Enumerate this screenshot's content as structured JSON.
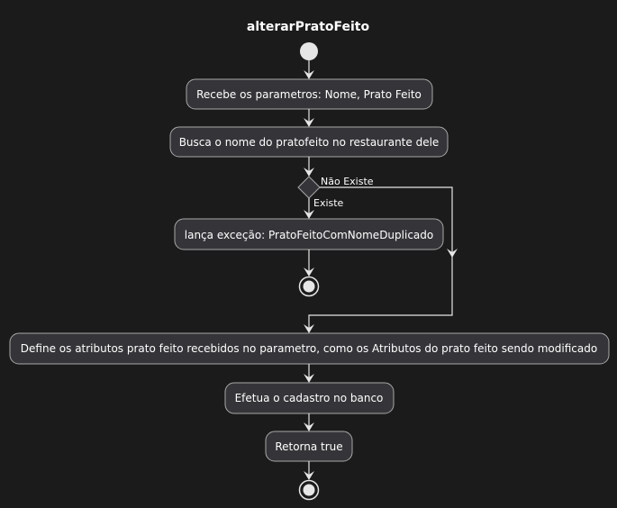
{
  "title": "alterarPratoFeito",
  "actions": {
    "receive_params": "Recebe os parametros: Nome, Prato Feito",
    "search_name": "Busca o nome do pratofeito no restaurante dele",
    "throw_exception": "lança exceção: PratoFeitoComNomeDuplicado",
    "define_attributes": "Define  os atributos prato feito recebidos no parametro, como os Atributos do prato feito sendo modificado",
    "register": "Efetua o cadastro no banco",
    "return_true": "Retorna true"
  },
  "decision": {
    "branch_false_label": "Não Existe",
    "branch_true_label": "Existe"
  },
  "colors": {
    "background": "#1b1b1c",
    "node_fill": "#353539",
    "node_border": "#a8a8a8",
    "edge": "#e6e6e6",
    "text": "#ffffff"
  }
}
